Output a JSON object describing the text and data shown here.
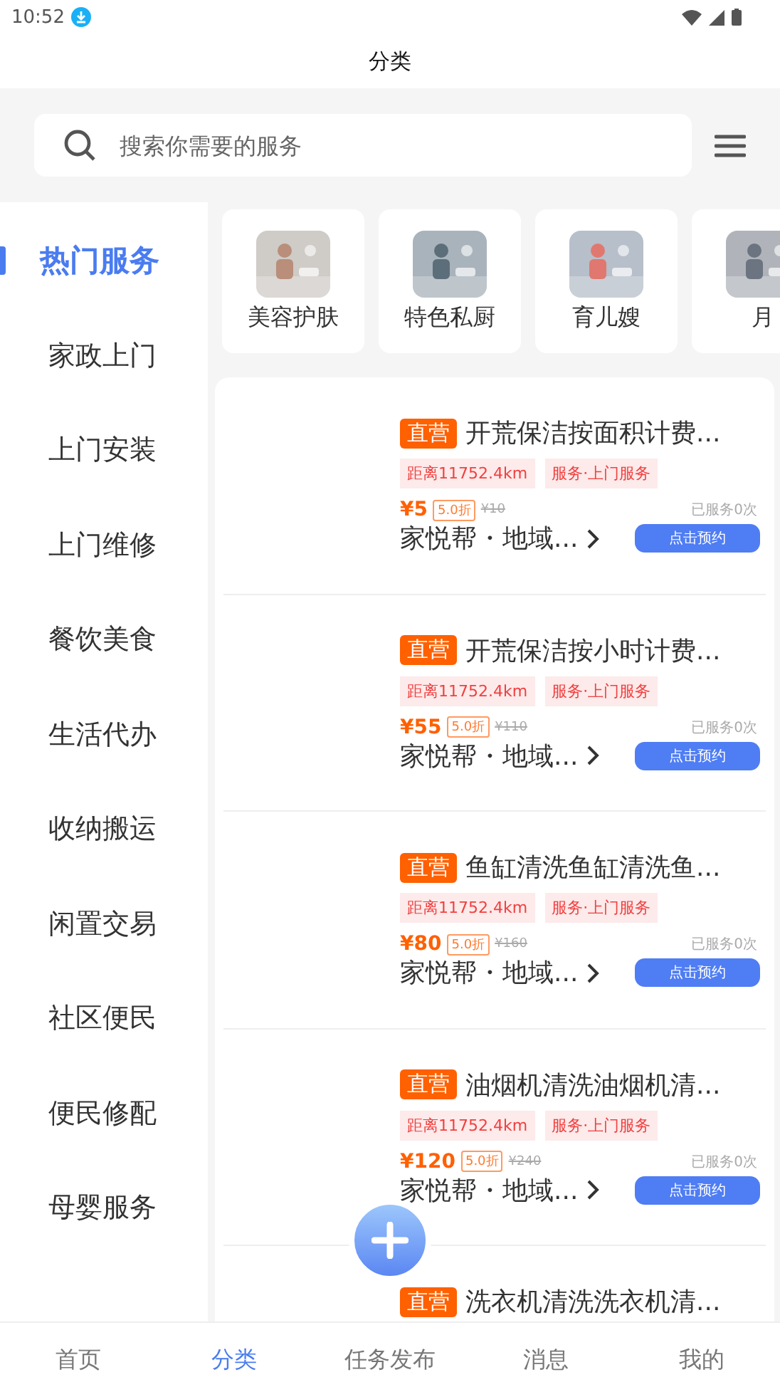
{
  "status_bar": {
    "time": "10:52"
  },
  "title": "分类",
  "search": {
    "placeholder": "搜索你需要的服务"
  },
  "sidebar": [
    {
      "label": "热门服务",
      "selected": true
    },
    {
      "label": "家政上门",
      "selected": false
    },
    {
      "label": "上门安装",
      "selected": false
    },
    {
      "label": "上门维修",
      "selected": false
    },
    {
      "label": "餐饮美食",
      "selected": false
    },
    {
      "label": "生活代办",
      "selected": false
    },
    {
      "label": "收纳搬运",
      "selected": false
    },
    {
      "label": "闲置交易",
      "selected": false
    },
    {
      "label": "社区便民",
      "selected": false
    },
    {
      "label": "便民修配",
      "selected": false
    },
    {
      "label": "母婴服务",
      "selected": false
    }
  ],
  "categories": [
    {
      "label": "美容护肤",
      "kind": "picture"
    },
    {
      "label": "特色私厨",
      "kind": "picture"
    },
    {
      "label": "育儿嫂",
      "kind": "picture"
    },
    {
      "label": "月",
      "kind": "picture"
    }
  ],
  "services": [
    {
      "badge": "直营",
      "title": "开荒保洁按面积计费...",
      "distance": "距离11752.4km",
      "tag": "服务·上门服务",
      "price": "¥5",
      "discount": "5.0折",
      "original_price": "¥10",
      "served": "已服务0次",
      "shop": "家悦帮・地域...",
      "action": "点击预约"
    },
    {
      "badge": "直营",
      "title": "开荒保洁按小时计费...",
      "distance": "距离11752.4km",
      "tag": "服务·上门服务",
      "price": "¥55",
      "discount": "5.0折",
      "original_price": "¥110",
      "served": "已服务0次",
      "shop": "家悦帮・地域...",
      "action": "点击预约"
    },
    {
      "badge": "直营",
      "title": "鱼缸清洗鱼缸清洗鱼...",
      "distance": "距离11752.4km",
      "tag": "服务·上门服务",
      "price": "¥80",
      "discount": "5.0折",
      "original_price": "¥160",
      "served": "已服务0次",
      "shop": "家悦帮・地域...",
      "action": "点击预约"
    },
    {
      "badge": "直营",
      "title": "油烟机清洗油烟机清...",
      "distance": "距离11752.4km",
      "tag": "服务·上门服务",
      "price": "¥120",
      "discount": "5.0折",
      "original_price": "¥240",
      "served": "已服务0次",
      "shop": "家悦帮・地域...",
      "action": "点击预约"
    },
    {
      "badge": "直营",
      "title": "洗衣机清洗洗衣机清..."
    }
  ],
  "bottom_nav": [
    {
      "label": "首页",
      "selected": false
    },
    {
      "label": "分类",
      "selected": true
    },
    {
      "label": "任务发布",
      "selected": false
    },
    {
      "label": "消息",
      "selected": false
    },
    {
      "label": "我的",
      "selected": false
    }
  ]
}
